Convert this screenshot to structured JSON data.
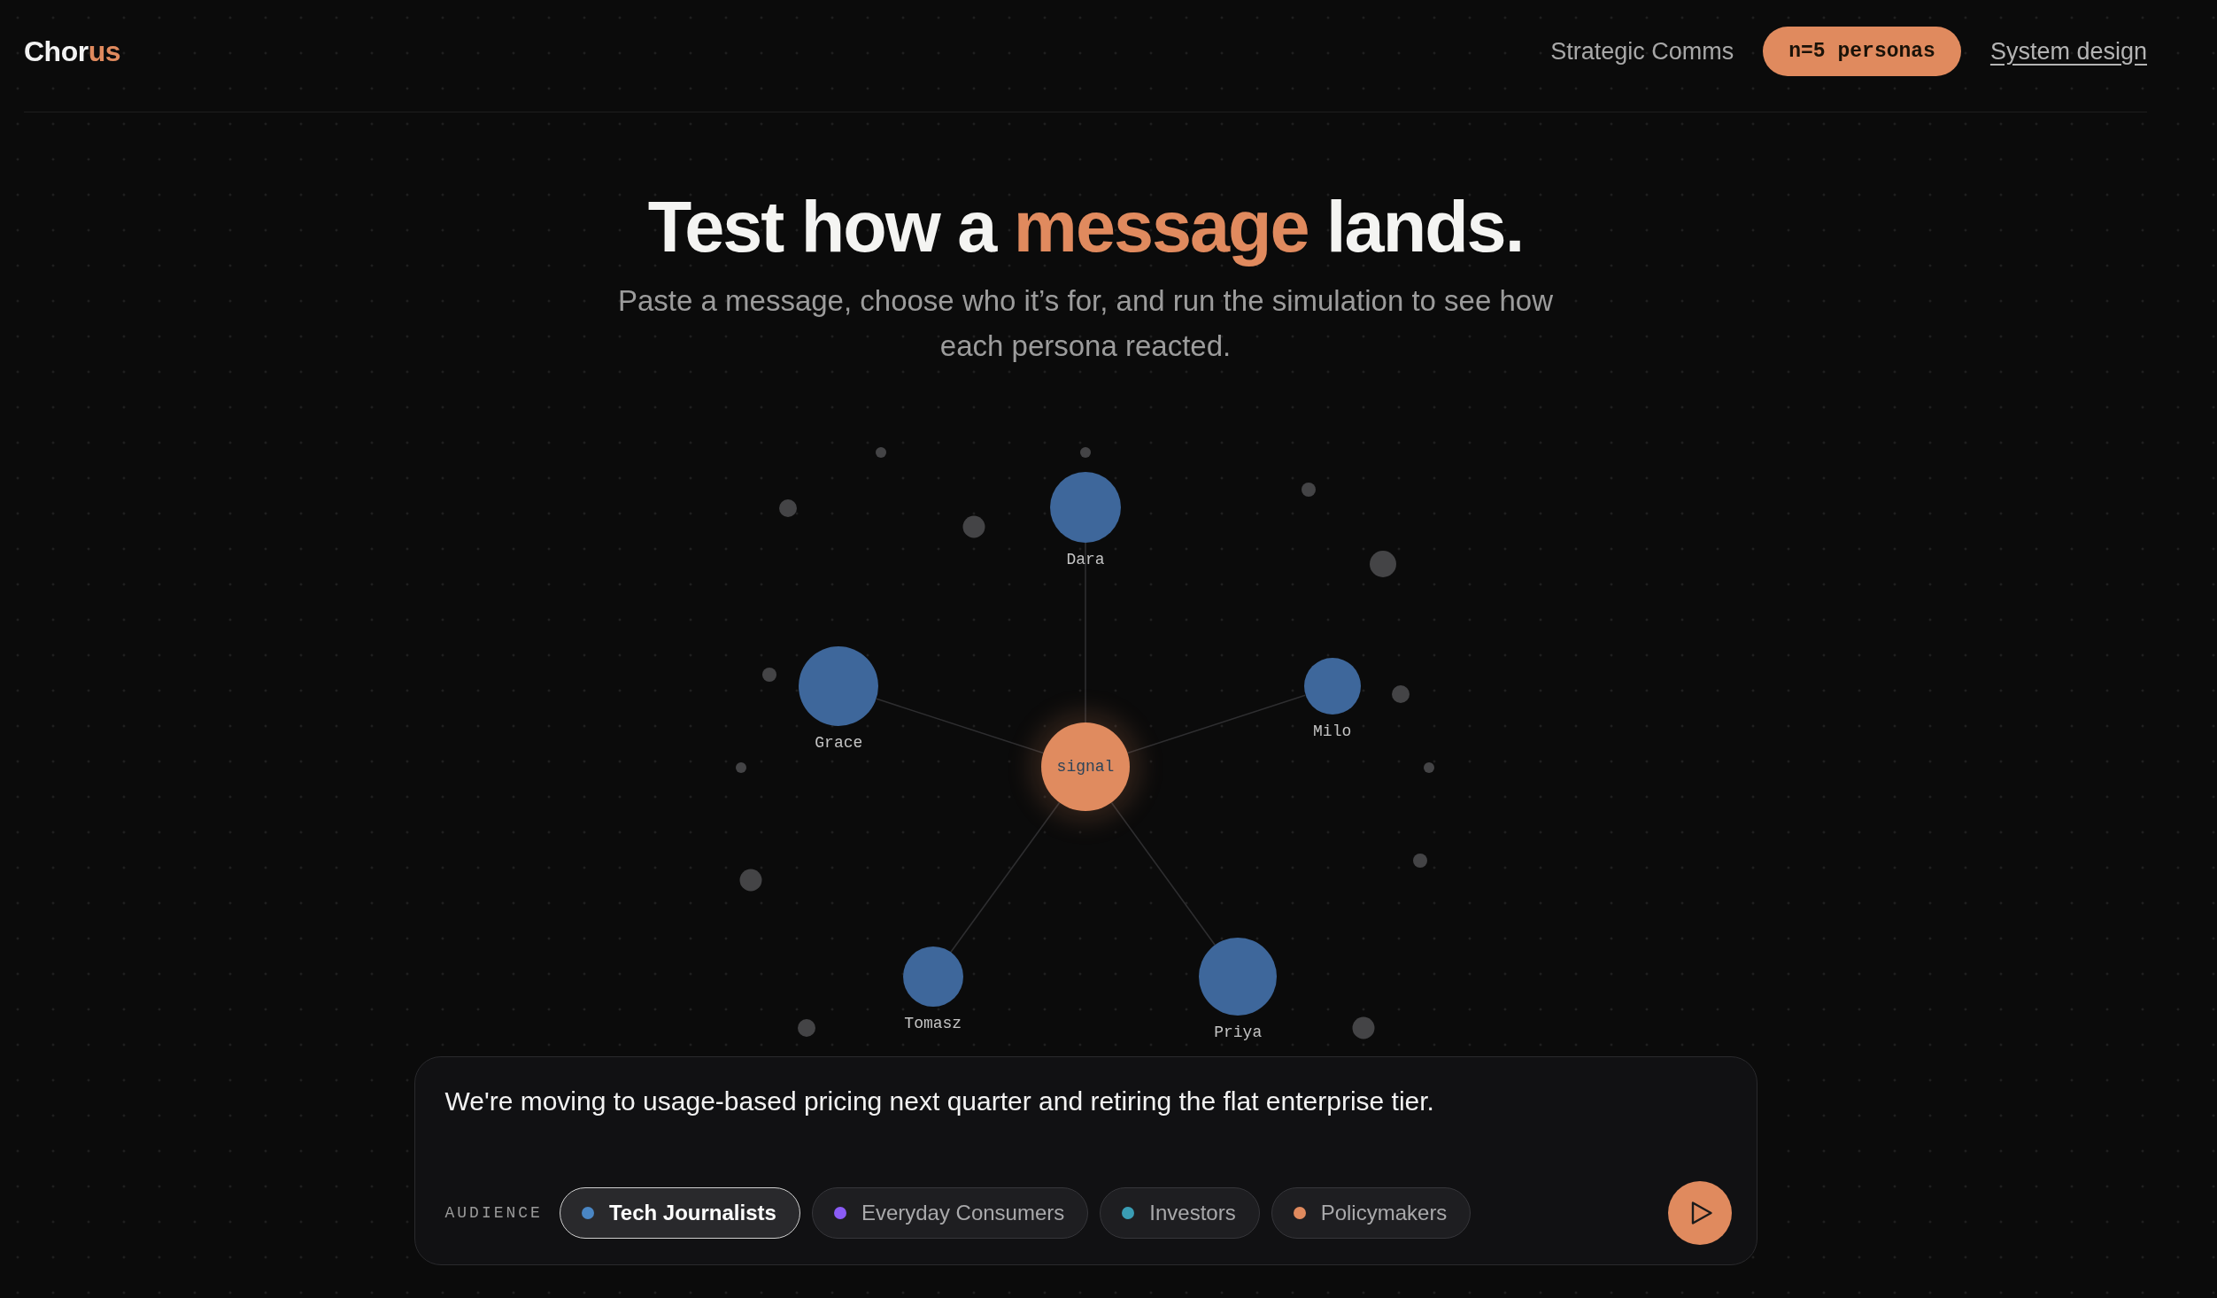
{
  "header": {
    "logo": {
      "text": "Chor",
      "accent": "us"
    },
    "nav": [
      {
        "kind": "link",
        "label": "Strategic Comms"
      },
      {
        "kind": "pill",
        "label": "n=5 personas"
      },
      {
        "kind": "underlined",
        "label": "System design"
      }
    ]
  },
  "hero": {
    "title": {
      "before": "Test how a ",
      "accent": "message",
      "after": " lands."
    },
    "subtitle": "Paste a message, choose who it’s for, and run the simulation to see how each persona reacted."
  },
  "graph": {
    "center_label": "signal",
    "personas": [
      {
        "name": "Dara"
      },
      {
        "name": "Milo"
      },
      {
        "name": "Priya"
      },
      {
        "name": "Tomasz"
      },
      {
        "name": "Grace"
      }
    ]
  },
  "composer": {
    "message": "We're moving to usage-based pricing next quarter and retiring the flat enterprise tier.",
    "audience_label": "AUDIENCE",
    "audiences": [
      {
        "label": "Tech Journalists",
        "color": "#4a86c4",
        "selected": true
      },
      {
        "label": "Everyday Consumers",
        "color": "#8b5cf6",
        "selected": false
      },
      {
        "label": "Investors",
        "color": "#3a9db4",
        "selected": false
      },
      {
        "label": "Policymakers",
        "color": "#e08a5e",
        "selected": false
      }
    ]
  }
}
